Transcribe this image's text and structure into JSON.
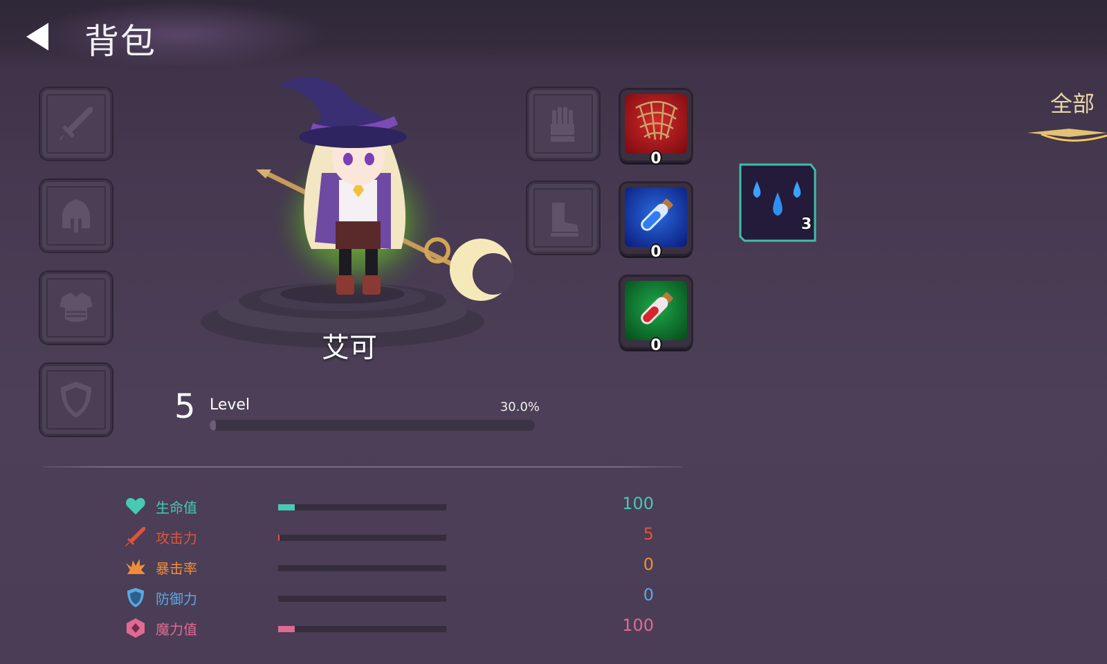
{
  "header": {
    "title": "背包"
  },
  "character": {
    "name": "艾可",
    "level": "5",
    "level_label": "Level",
    "exp_percent": "30.0%",
    "exp_fraction": 0.02
  },
  "equip_slots_left": [
    {
      "name": "weapon",
      "icon": "sword-icon"
    },
    {
      "name": "helmet",
      "icon": "helmet-icon"
    },
    {
      "name": "armor",
      "icon": "armor-icon"
    },
    {
      "name": "shield",
      "icon": "shield-icon"
    }
  ],
  "equip_slots_right": [
    {
      "name": "gloves",
      "icon": "glove-icon"
    },
    {
      "name": "boots",
      "icon": "boot-icon"
    }
  ],
  "quick_items": [
    {
      "name": "net",
      "icon": "net-icon",
      "count": "0",
      "bg": "#b3121a"
    },
    {
      "name": "blue-potion",
      "icon": "blue-potion-icon",
      "count": "0",
      "bg": "#1232b8"
    },
    {
      "name": "red-potion",
      "icon": "red-potion-icon",
      "count": "0",
      "bg": "#0f7a2c"
    }
  ],
  "stats": [
    {
      "label": "生命值",
      "value": "100",
      "color": "#47c9b4",
      "fill": 0.1,
      "icon": "heart-icon"
    },
    {
      "label": "攻击力",
      "value": "5",
      "color": "#e0533a",
      "fill": 0.01,
      "icon": "sword-icon"
    },
    {
      "label": "暴击率",
      "value": "0",
      "color": "#f28c3b",
      "fill": 0,
      "icon": "crit-icon"
    },
    {
      "label": "防御力",
      "value": "0",
      "color": "#5aa8e3",
      "fill": 0,
      "icon": "shield-icon"
    },
    {
      "label": "魔力值",
      "value": "100",
      "color": "#e06a93",
      "fill": 0.1,
      "icon": "magic-icon"
    }
  ],
  "inventory": {
    "filter_label": "全部",
    "items": [
      {
        "name": "water-drops",
        "icon": "water-drops-icon",
        "count": "3"
      }
    ]
  }
}
